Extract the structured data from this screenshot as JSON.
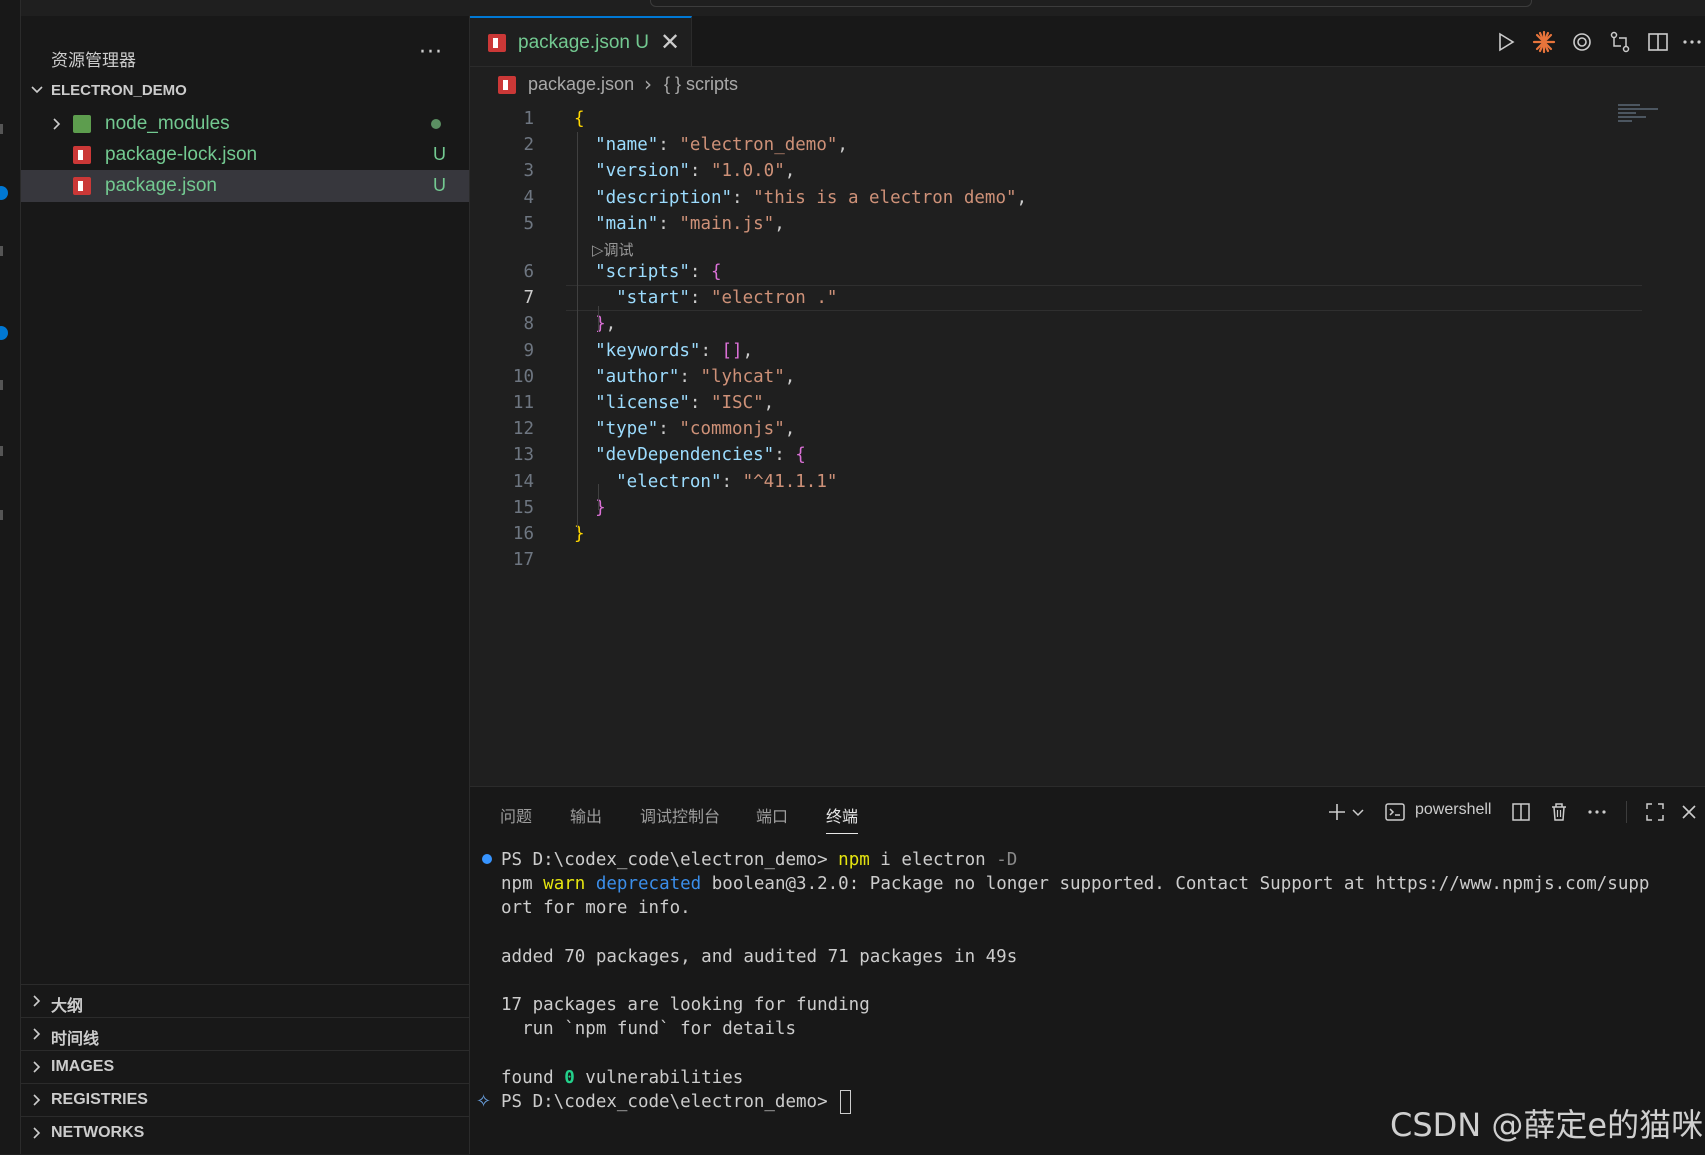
{
  "sidebar": {
    "title": "资源管理器",
    "more": "···",
    "root": "ELECTRON_DEMO",
    "items": [
      {
        "name": "node_modules",
        "badge": ""
      },
      {
        "name": "package-lock.json",
        "badge": "U"
      },
      {
        "name": "package.json",
        "badge": "U"
      }
    ],
    "sections": [
      "大纲",
      "时间线",
      "IMAGES",
      "REGISTRIES",
      "NETWORKS"
    ]
  },
  "editor": {
    "tab_name": "package.json",
    "tab_badge": "U",
    "tab_close": "✕",
    "breadcrumb_file": "package.json",
    "breadcrumb_sep": "›",
    "breadcrumb_symbol": "{ } scripts",
    "codelens": "▷调试",
    "line_numbers": [
      "1",
      "2",
      "3",
      "4",
      "5",
      "6",
      "7",
      "8",
      "9",
      "10",
      "11",
      "12",
      "13",
      "14",
      "15",
      "16",
      "17"
    ],
    "code": [
      [
        {
          "t": "{",
          "c": "b1"
        }
      ],
      [
        {
          "t": "  \"name\"",
          "c": "k"
        },
        {
          "t": ": ",
          "c": "p"
        },
        {
          "t": "\"electron_demo\"",
          "c": "s"
        },
        {
          "t": ",",
          "c": "p"
        }
      ],
      [
        {
          "t": "  \"version\"",
          "c": "k"
        },
        {
          "t": ": ",
          "c": "p"
        },
        {
          "t": "\"1.0.0\"",
          "c": "s"
        },
        {
          "t": ",",
          "c": "p"
        }
      ],
      [
        {
          "t": "  \"description\"",
          "c": "k"
        },
        {
          "t": ": ",
          "c": "p"
        },
        {
          "t": "\"this is a electron demo\"",
          "c": "s"
        },
        {
          "t": ",",
          "c": "p"
        }
      ],
      [
        {
          "t": "  \"main\"",
          "c": "k"
        },
        {
          "t": ": ",
          "c": "p"
        },
        {
          "t": "\"main.js\"",
          "c": "s"
        },
        {
          "t": ",",
          "c": "p"
        }
      ],
      [
        {
          "t": "  \"scripts\"",
          "c": "k"
        },
        {
          "t": ": ",
          "c": "p"
        },
        {
          "t": "{",
          "c": "b2"
        }
      ],
      [
        {
          "t": "    \"start\"",
          "c": "k"
        },
        {
          "t": ": ",
          "c": "p"
        },
        {
          "t": "\"electron .\"",
          "c": "s"
        }
      ],
      [
        {
          "t": "  }",
          "c": "b2"
        },
        {
          "t": ",",
          "c": "p"
        }
      ],
      [
        {
          "t": "  \"keywords\"",
          "c": "k"
        },
        {
          "t": ": ",
          "c": "p"
        },
        {
          "t": "[]",
          "c": "b2"
        },
        {
          "t": ",",
          "c": "p"
        }
      ],
      [
        {
          "t": "  \"author\"",
          "c": "k"
        },
        {
          "t": ": ",
          "c": "p"
        },
        {
          "t": "\"lyhcat\"",
          "c": "s"
        },
        {
          "t": ",",
          "c": "p"
        }
      ],
      [
        {
          "t": "  \"license\"",
          "c": "k"
        },
        {
          "t": ": ",
          "c": "p"
        },
        {
          "t": "\"ISC\"",
          "c": "s"
        },
        {
          "t": ",",
          "c": "p"
        }
      ],
      [
        {
          "t": "  \"type\"",
          "c": "k"
        },
        {
          "t": ": ",
          "c": "p"
        },
        {
          "t": "\"commonjs\"",
          "c": "s"
        },
        {
          "t": ",",
          "c": "p"
        }
      ],
      [
        {
          "t": "  \"devDependencies\"",
          "c": "k"
        },
        {
          "t": ": ",
          "c": "p"
        },
        {
          "t": "{",
          "c": "b2"
        }
      ],
      [
        {
          "t": "    \"electron\"",
          "c": "k"
        },
        {
          "t": ": ",
          "c": "p"
        },
        {
          "t": "\"^41.1.1\"",
          "c": "s"
        }
      ],
      [
        {
          "t": "  }",
          "c": "b2"
        }
      ],
      [
        {
          "t": "}",
          "c": "b1"
        }
      ],
      []
    ]
  },
  "panel": {
    "tabs": [
      "问题",
      "输出",
      "调试控制台",
      "端口",
      "终端"
    ],
    "active_tab": "终端",
    "shell_label": "powershell",
    "more": "···",
    "terminal": [
      [
        {
          "t": "PS D:\\codex_code\\electron_demo> ",
          "c": ""
        },
        {
          "t": "npm",
          "c": "ty"
        },
        {
          "t": " i electron ",
          "c": ""
        },
        {
          "t": "-D",
          "c": "tdim"
        }
      ],
      [
        {
          "t": "npm ",
          "c": ""
        },
        {
          "t": "warn",
          "c": "ty"
        },
        {
          "t": " ",
          "c": ""
        },
        {
          "t": "deprecated",
          "c": "tb"
        },
        {
          "t": " boolean@3.2.0: Package no longer supported. Contact Support at https://www.npmjs.com/supp",
          "c": ""
        }
      ],
      [
        {
          "t": "ort for more info.",
          "c": ""
        }
      ],
      [],
      [
        {
          "t": "added 70 packages, and audited 71 packages in 49s",
          "c": ""
        }
      ],
      [],
      [
        {
          "t": "17 packages are looking for funding",
          "c": ""
        }
      ],
      [
        {
          "t": "  run `npm fund` for details",
          "c": ""
        }
      ],
      [],
      [
        {
          "t": "found ",
          "c": ""
        },
        {
          "t": "0",
          "c": "tg"
        },
        {
          "t": " vulnerabilities",
          "c": ""
        }
      ],
      [
        {
          "t": "PS D:\\codex_code\\electron_demo> ",
          "c": ""
        }
      ]
    ]
  },
  "watermark": "CSDN @薛定e的猫咪",
  "colors": {
    "accent": "#0078d4",
    "untracked": "#73c991",
    "key": "#9cdcfe",
    "string": "#ce9178",
    "bracket1": "#ffd700",
    "bracket2": "#da70d6",
    "npm_red": "#cb3837"
  },
  "icons": {
    "toolbar": [
      "run-icon",
      "claude-icon",
      "openai-icon",
      "compare-changes-icon",
      "split-editor-icon",
      "more-actions-icon"
    ],
    "panel": [
      "new-terminal-icon",
      "terminal-dropdown-icon",
      "terminal-icon",
      "split-terminal-icon",
      "trash-icon",
      "maximize-panel-icon",
      "close-panel-icon"
    ]
  }
}
